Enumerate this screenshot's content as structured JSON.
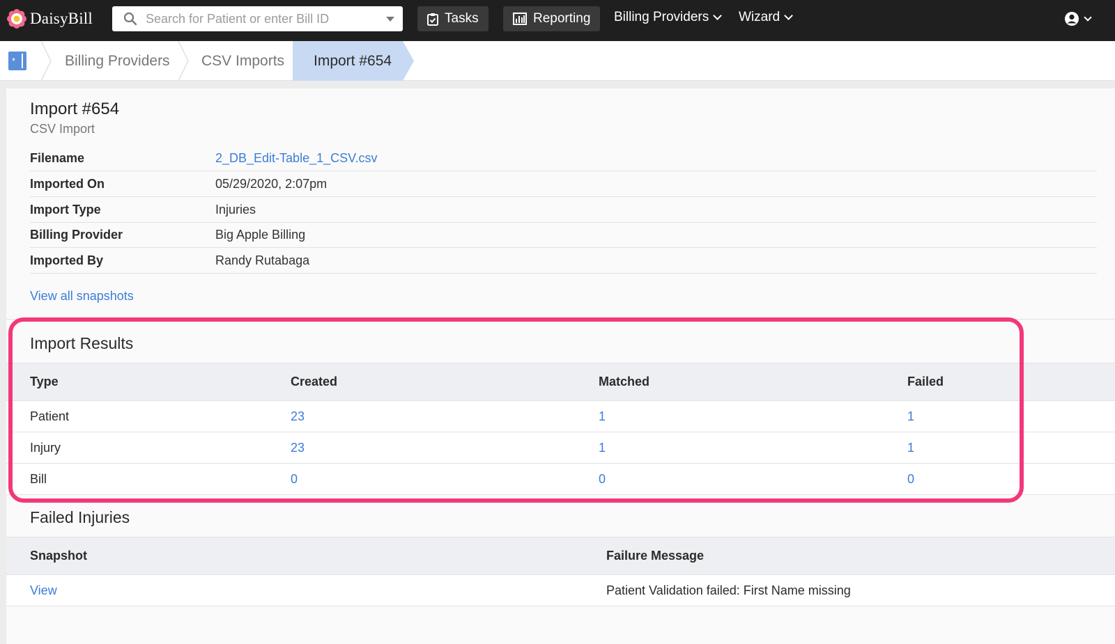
{
  "app": {
    "name": "DaisyBill"
  },
  "search": {
    "placeholder": "Search for Patient or enter Bill ID"
  },
  "nav": {
    "tasks": "Tasks",
    "reporting": "Reporting",
    "billing_providers": "Billing Providers",
    "wizard": "Wizard"
  },
  "breadcrumb": {
    "items": [
      "Billing Providers",
      "CSV Imports"
    ],
    "current": "Import #654"
  },
  "import": {
    "title": "Import #654",
    "subtitle": "CSV Import",
    "details": [
      {
        "label": "Filename",
        "value": "2_DB_Edit-Table_1_CSV.csv"
      },
      {
        "label": "Imported On",
        "value": "05/29/2020, 2:07pm"
      },
      {
        "label": "Import Type",
        "value": "Injuries"
      },
      {
        "label": "Billing Provider",
        "value": "Big Apple Billing"
      },
      {
        "label": "Imported By",
        "value": "Randy Rutabaga"
      }
    ],
    "snapshots_link": "View all snapshots"
  },
  "results": {
    "title": "Import Results",
    "headers": [
      "Type",
      "Created",
      "Matched",
      "Failed"
    ],
    "rows": [
      {
        "type": "Patient",
        "created": "23",
        "matched": "1",
        "failed": "1"
      },
      {
        "type": "Injury",
        "created": "23",
        "matched": "1",
        "failed": "1"
      },
      {
        "type": "Bill",
        "created": "0",
        "matched": "0",
        "failed": "0"
      }
    ]
  },
  "failed": {
    "title": "Failed Injuries",
    "headers": [
      "Snapshot",
      "Failure Message"
    ],
    "rows": [
      {
        "snapshot": "View",
        "message": "Patient Validation failed: First Name missing"
      }
    ]
  },
  "colors": {
    "accent": "#3b7dd8",
    "topbar": "#1f1f1f",
    "highlight": "#f2387a",
    "crumb_active": "#c8daf3"
  }
}
